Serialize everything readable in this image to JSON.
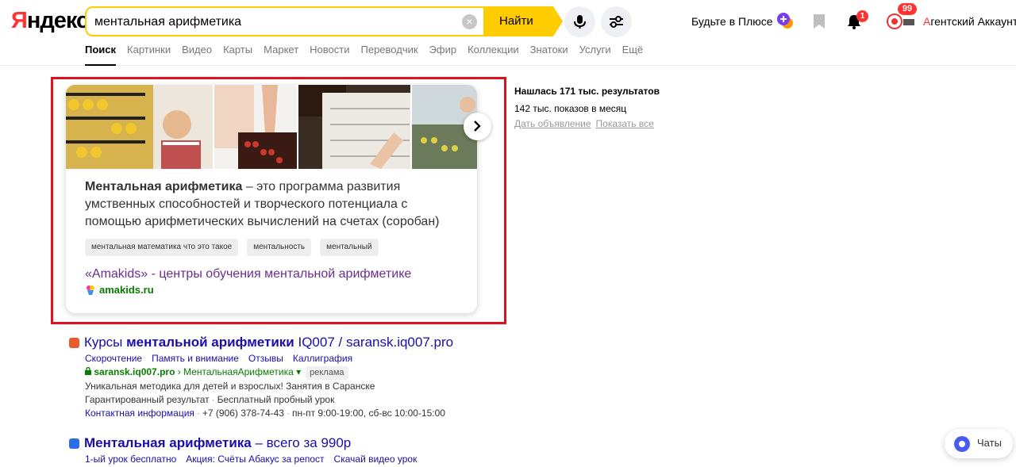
{
  "header": {
    "logo": "Яндекс",
    "search_value": "ментальная арифметика",
    "find_label": "Найти",
    "plus_text": "Будьте в Плюсе",
    "notifications_count": "1",
    "avatar_badge": "99",
    "account_name_first": "А",
    "account_name_rest": "гентский Аккаунт"
  },
  "nav": [
    "Поиск",
    "Картинки",
    "Видео",
    "Карты",
    "Маркет",
    "Новости",
    "Переводчик",
    "Эфир",
    "Коллекции",
    "Знатоки",
    "Услуги",
    "Ещё"
  ],
  "card": {
    "desc_bold": "Ментальная арифметика",
    "desc_rest": " – это программа развития умственных способностей и творческого потенциала с помощью арифметических вычислений на счетах (соробан)",
    "chips": [
      "ментальная математика что это такое",
      "ментальность",
      "ментальный"
    ],
    "link": "«Amakids» - центры обучения ментальной арифметике",
    "domain": "amakids.ru"
  },
  "side": {
    "title": "Нашлась 171 тыс. результатов",
    "shows": "142 тыс. показов в месяц",
    "link_ad": "Дать объявление",
    "link_all": "Показать все"
  },
  "results": [
    {
      "title_prefix": "Курсы ",
      "title_bold": "ментальной арифметики",
      "title_suffix": " IQ007 / saransk.iq007.pro",
      "sitelinks": [
        "Скорочтение",
        "Память и внимание",
        "Отзывы",
        "Каллиграфия"
      ],
      "url_domain": "saransk.iq007.pro",
      "url_path": "МентальнаяАрифметика",
      "ad_label": "реклама",
      "text1": "Уникальная методика для детей и взрослых! Занятия в Саранске",
      "text2a": "Гарантированный результат",
      "text2b": "Бесплатный пробный урок",
      "contact_link": "Контактная информация",
      "phone": "+7 (906) 378-74-43",
      "hours": "пн-пт 9:00-19:00, сб-вс 10:00-15:00"
    },
    {
      "title_bold": "Ментальная арифметика",
      "title_suffix": " – всего за 990р",
      "sitelinks": [
        "1-ый урок бесплатно",
        "Акция: Счёты Абакус за репост",
        "Скачай видео урок"
      ]
    }
  ],
  "chats_label": "Чаты",
  "colors": {
    "accent": "#ffcc00",
    "highlight": "#e0101e",
    "link": "#1a0dab",
    "url": "#077d00",
    "visited": "#6b2e8f"
  }
}
